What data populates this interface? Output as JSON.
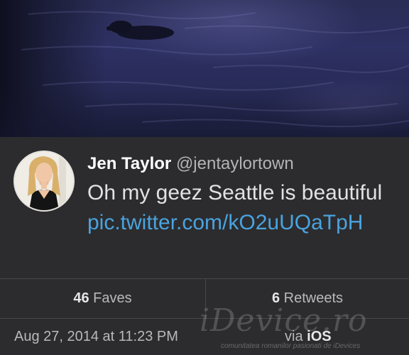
{
  "tweet": {
    "author": {
      "name": "Jen Taylor",
      "handle": "@jentaylortown"
    },
    "text_plain": "Oh my geez Seattle is beautiful",
    "text_link": "pic.twitter.com/kO2uUQaTpH",
    "stats": {
      "faves_count": "46",
      "faves_label": "Faves",
      "retweets_count": "6",
      "retweets_label": "Retweets"
    },
    "timestamp": "Aug 27, 2014 at 11:23 PM",
    "via_prefix": "via",
    "via_app": "iOS"
  },
  "watermark": {
    "brand": "iDevice.ro",
    "tagline": "comunitatea romanilor pasionati de iDevices"
  },
  "colors": {
    "background": "#2c2c2e",
    "link": "#4aa3df",
    "divider": "#47474b"
  }
}
